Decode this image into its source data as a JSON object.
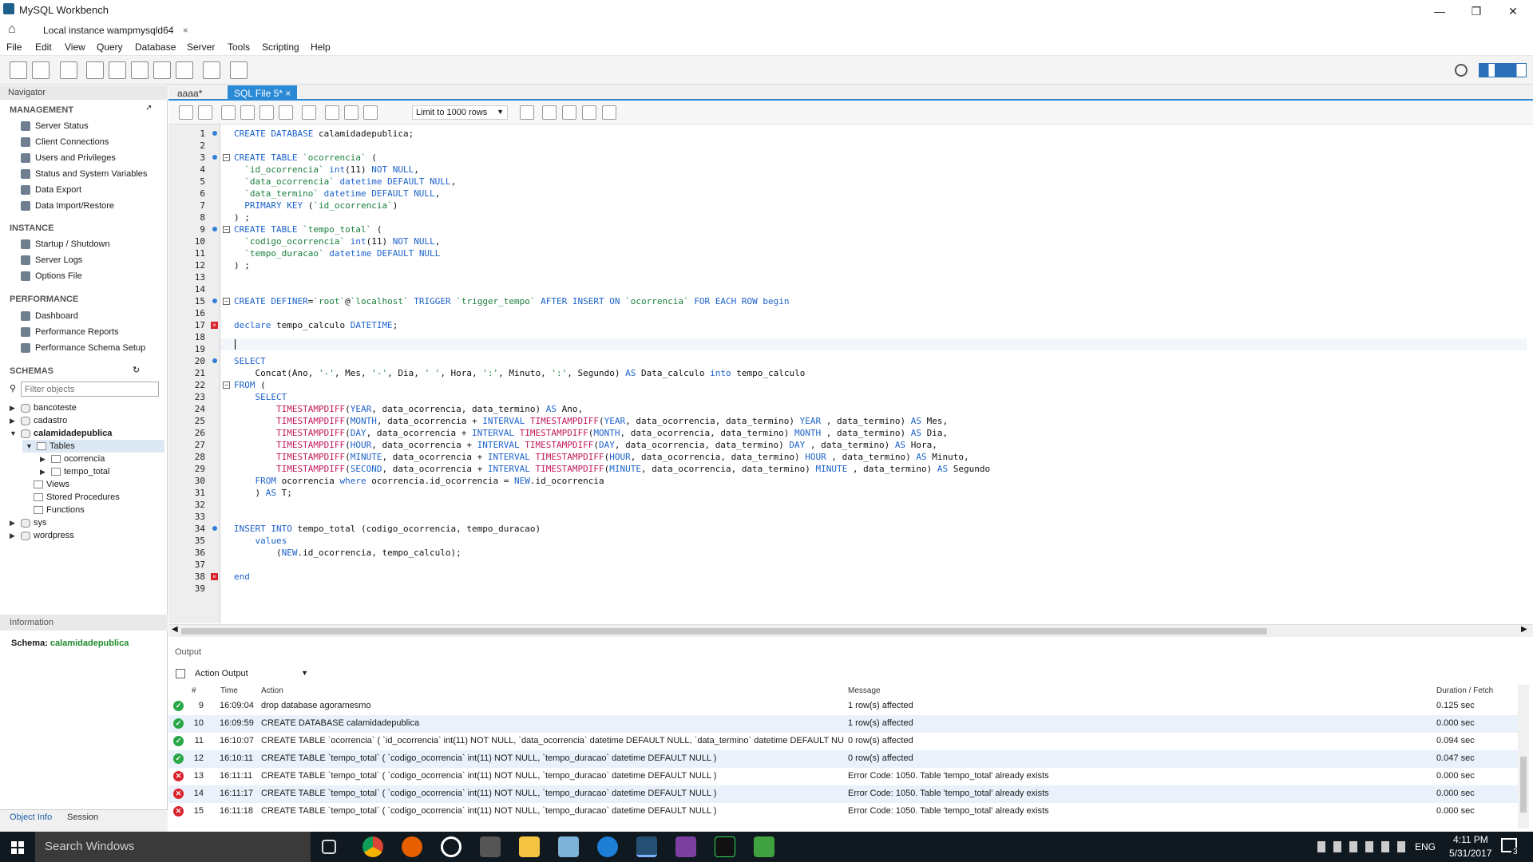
{
  "window": {
    "title": "MySQL Workbench",
    "connection_tab": "Local instance wampmysqld64"
  },
  "menu": [
    "File",
    "Edit",
    "View",
    "Query",
    "Database",
    "Server",
    "Tools",
    "Scripting",
    "Help"
  ],
  "navigator": {
    "title": "Navigator",
    "management": {
      "label": "MANAGEMENT",
      "items": [
        "Server Status",
        "Client Connections",
        "Users and Privileges",
        "Status and System Variables",
        "Data Export",
        "Data Import/Restore"
      ]
    },
    "instance": {
      "label": "INSTANCE",
      "items": [
        "Startup / Shutdown",
        "Server Logs",
        "Options File"
      ]
    },
    "performance": {
      "label": "PERFORMANCE",
      "items": [
        "Dashboard",
        "Performance Reports",
        "Performance Schema Setup"
      ]
    },
    "schemas": {
      "label": "SCHEMAS",
      "filter_placeholder": "Filter objects",
      "dbs": [
        "bancoteste",
        "cadastro",
        "calamidadepublica"
      ],
      "tables_label": "Tables",
      "tables": [
        "ocorrencia",
        "tempo_total"
      ],
      "others": [
        "Views",
        "Stored Procedures",
        "Functions"
      ],
      "more_dbs": [
        "sys",
        "wordpress"
      ]
    },
    "info_label": "Information",
    "schema_label": "Schema:",
    "schema_value": "calamidadepublica",
    "bottom_tabs": [
      "Object Info",
      "Session"
    ]
  },
  "editor": {
    "tabs": [
      "aaaa*",
      "SQL File 5*"
    ],
    "limit": "Limit to 1000 rows",
    "lines": [
      "CREATE DATABASE calamidadepublica;",
      "",
      "CREATE TABLE `ocorrencia` (",
      "  `id_ocorrencia` int(11) NOT NULL,",
      "  `data_ocorrencia` datetime DEFAULT NULL,",
      "  `data_termino` datetime DEFAULT NULL,",
      "  PRIMARY KEY (`id_ocorrencia`)",
      ") ;",
      "CREATE TABLE `tempo_total` (",
      "  `codigo_ocorrencia` int(11) NOT NULL,",
      "  `tempo_duracao` datetime DEFAULT NULL",
      ") ;",
      "",
      "",
      "CREATE DEFINER=`root`@`localhost` TRIGGER `trigger_tempo` AFTER INSERT ON `ocorrencia` FOR EACH ROW begin",
      "",
      "declare tempo_calculo DATETIME;",
      "",
      "",
      "SELECT",
      "    Concat(Ano, '-', Mes, '-', Dia, ' ', Hora, ':', Minuto, ':', Segundo) AS Data_calculo into tempo_calculo",
      "FROM (",
      "    SELECT",
      "        TIMESTAMPDIFF(YEAR, data_ocorrencia, data_termino) AS Ano,",
      "        TIMESTAMPDIFF(MONTH, data_ocorrencia + INTERVAL TIMESTAMPDIFF(YEAR, data_ocorrencia, data_termino) YEAR , data_termino) AS Mes,",
      "        TIMESTAMPDIFF(DAY, data_ocorrencia + INTERVAL TIMESTAMPDIFF(MONTH, data_ocorrencia, data_termino) MONTH , data_termino) AS Dia,",
      "        TIMESTAMPDIFF(HOUR, data_ocorrencia + INTERVAL TIMESTAMPDIFF(DAY, data_ocorrencia, data_termino) DAY , data_termino) AS Hora,",
      "        TIMESTAMPDIFF(MINUTE, data_ocorrencia + INTERVAL TIMESTAMPDIFF(HOUR, data_ocorrencia, data_termino) HOUR , data_termino) AS Minuto,",
      "        TIMESTAMPDIFF(SECOND, data_ocorrencia + INTERVAL TIMESTAMPDIFF(MINUTE, data_ocorrencia, data_termino) MINUTE , data_termino) AS Segundo",
      "    FROM ocorrencia where ocorrencia.id_ocorrencia = NEW.id_ocorrencia",
      "    ) AS T;",
      "",
      "",
      "INSERT INTO tempo_total (codigo_ocorrencia, tempo_duracao)",
      "    values",
      "        (NEW.id_ocorrencia, tempo_calculo);",
      "",
      "end",
      ""
    ]
  },
  "output": {
    "title": "Output",
    "selector": "Action Output",
    "headers": [
      "#",
      "Time",
      "Action",
      "Message",
      "Duration / Fetch"
    ],
    "rows": [
      {
        "n": "9",
        "time": "16:09:04",
        "action": "drop database agoramesmo",
        "msg": "1 row(s) affected",
        "dur": "0.125 sec",
        "ok": true
      },
      {
        "n": "10",
        "time": "16:09:59",
        "action": "CREATE DATABASE calamidadepublica",
        "msg": "1 row(s) affected",
        "dur": "0.000 sec",
        "ok": true
      },
      {
        "n": "11",
        "time": "16:10:07",
        "action": "CREATE TABLE `ocorrencia` (  `id_ocorrencia` int(11) NOT NULL,  `data_ocorrencia` datetime DEFAULT NULL,  `data_termino` datetime DEFAULT NU...",
        "msg": "0 row(s) affected",
        "dur": "0.094 sec",
        "ok": true
      },
      {
        "n": "12",
        "time": "16:10:11",
        "action": "CREATE TABLE `tempo_total` (  `codigo_ocorrencia` int(11) NOT NULL,  `tempo_duracao` datetime DEFAULT NULL )",
        "msg": "0 row(s) affected",
        "dur": "0.047 sec",
        "ok": true
      },
      {
        "n": "13",
        "time": "16:11:11",
        "action": "CREATE TABLE `tempo_total` (  `codigo_ocorrencia` int(11) NOT NULL,  `tempo_duracao` datetime DEFAULT NULL )",
        "msg": "Error Code: 1050. Table 'tempo_total' already exists",
        "dur": "0.000 sec",
        "ok": false
      },
      {
        "n": "14",
        "time": "16:11:17",
        "action": "CREATE TABLE `tempo_total` (  `codigo_ocorrencia` int(11) NOT NULL,  `tempo_duracao` datetime DEFAULT NULL )",
        "msg": "Error Code: 1050. Table 'tempo_total' already exists",
        "dur": "0.000 sec",
        "ok": false
      },
      {
        "n": "15",
        "time": "16:11:18",
        "action": "CREATE TABLE `tempo_total` (  `codigo_ocorrencia` int(11) NOT NULL,  `tempo_duracao` datetime DEFAULT NULL )",
        "msg": "Error Code: 1050. Table 'tempo_total' already exists",
        "dur": "0.000 sec",
        "ok": false
      }
    ]
  },
  "taskbar": {
    "search": "Search Windows",
    "lang": "ENG",
    "time": "4:11 PM",
    "date": "5/31/2017",
    "notif_count": "3"
  }
}
